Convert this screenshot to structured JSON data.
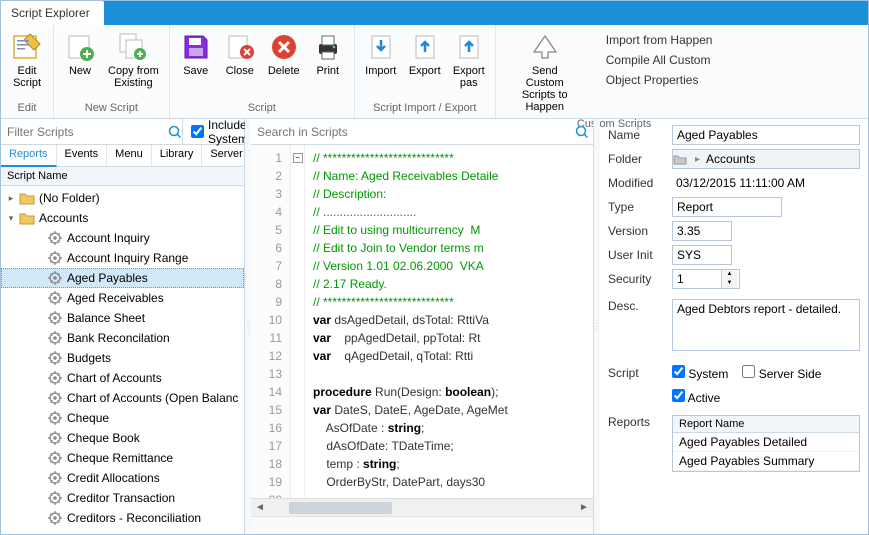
{
  "title": "Script Explorer",
  "ribbon": {
    "groups": [
      {
        "label": "Edit",
        "buttons": [
          {
            "name": "edit-script",
            "label": "Edit\nScript"
          }
        ]
      },
      {
        "label": "New Script",
        "buttons": [
          {
            "name": "new",
            "label": "New"
          },
          {
            "name": "copy-from-existing",
            "label": "Copy from\nExisting"
          }
        ]
      },
      {
        "label": "Script",
        "buttons": [
          {
            "name": "save",
            "label": "Save"
          },
          {
            "name": "close",
            "label": "Close"
          },
          {
            "name": "delete",
            "label": "Delete"
          },
          {
            "name": "print",
            "label": "Print"
          }
        ]
      },
      {
        "label": "Script Import / Export",
        "buttons": [
          {
            "name": "import",
            "label": "Import"
          },
          {
            "name": "export",
            "label": "Export"
          },
          {
            "name": "export-pas",
            "label": "Export\npas"
          }
        ]
      },
      {
        "label": "Custom Scripts",
        "buttons": [
          {
            "name": "send-custom",
            "label": "Send Custom\nScripts to Happen"
          }
        ]
      }
    ],
    "links": [
      "Import from Happen",
      "Compile All Custom",
      "Object Properties"
    ]
  },
  "leftPane": {
    "filterPlaceholder": "Filter Scripts",
    "includeSystem": "Include System",
    "tabs": [
      "Reports",
      "Events",
      "Menu",
      "Library",
      "Server"
    ],
    "activeTab": 0,
    "gridHeader": "Script Name",
    "tree": [
      {
        "type": "folder",
        "level": 0,
        "expanded": false,
        "label": "(No Folder)"
      },
      {
        "type": "folder",
        "level": 0,
        "expanded": true,
        "label": "Accounts"
      },
      {
        "type": "item",
        "level": 1,
        "label": "Account Inquiry"
      },
      {
        "type": "item",
        "level": 1,
        "label": "Account Inquiry Range"
      },
      {
        "type": "item",
        "level": 1,
        "label": "Aged Payables",
        "selected": true
      },
      {
        "type": "item",
        "level": 1,
        "label": "Aged Receivables"
      },
      {
        "type": "item",
        "level": 1,
        "label": "Balance Sheet"
      },
      {
        "type": "item",
        "level": 1,
        "label": "Bank Reconcilation"
      },
      {
        "type": "item",
        "level": 1,
        "label": "Budgets"
      },
      {
        "type": "item",
        "level": 1,
        "label": "Chart of Accounts"
      },
      {
        "type": "item",
        "level": 1,
        "label": "Chart of Accounts (Open Balanc"
      },
      {
        "type": "item",
        "level": 1,
        "label": "Cheque"
      },
      {
        "type": "item",
        "level": 1,
        "label": "Cheque Book"
      },
      {
        "type": "item",
        "level": 1,
        "label": "Cheque Remittance"
      },
      {
        "type": "item",
        "level": 1,
        "label": "Credit Allocations"
      },
      {
        "type": "item",
        "level": 1,
        "label": "Creditor Transaction"
      },
      {
        "type": "item",
        "level": 1,
        "label": "Creditors - Reconciliation"
      }
    ]
  },
  "editor": {
    "searchPlaceholder": "Search in Scripts",
    "lines": [
      "// ****************************",
      "// Name: Aged Receivables Detaile",
      "// Description:",
      "// ............................",
      "// Edit to using multicurrency  M",
      "// Edit to Join to Vendor terms m",
      "// Version 1.01 02.06.2000  VKA",
      "// 2.17 Ready.",
      "// ****************************",
      "var dsAgedDetail, dsTotal: RttiVa",
      "var    ppAgedDetail, ppTotal: Rt",
      "var    qAgedDetail, qTotal: Rtti",
      "",
      "procedure Run(Design: boolean);",
      "var DateS, DateE, AgeDate, AgeMet",
      "    AsOfDate : string;",
      "    dAsOfDate: TDateTime;",
      "    temp : string;",
      "    OrderByStr, DatePart, days30",
      ""
    ]
  },
  "props": {
    "nameLabel": "Name",
    "name": "Aged Payables",
    "folderLabel": "Folder",
    "folder": "Accounts",
    "modifiedLabel": "Modified",
    "modified": "03/12/2015 11:11:00 AM",
    "typeLabel": "Type",
    "type": "Report",
    "versionLabel": "Version",
    "version": "3.35",
    "userInitLabel": "User Init",
    "userInit": "SYS",
    "securityLabel": "Security",
    "security": "1",
    "descLabel": "Desc.",
    "desc": "Aged Debtors report - detailed.",
    "scriptLabel": "Script",
    "systemCb": "System",
    "serverSideCb": "Server Side",
    "activeCb": "Active",
    "reportsLabel": "Reports",
    "reportsHeader": "Report Name",
    "reportsRows": [
      "Aged Payables Detailed",
      "Aged Payables Summary"
    ]
  }
}
